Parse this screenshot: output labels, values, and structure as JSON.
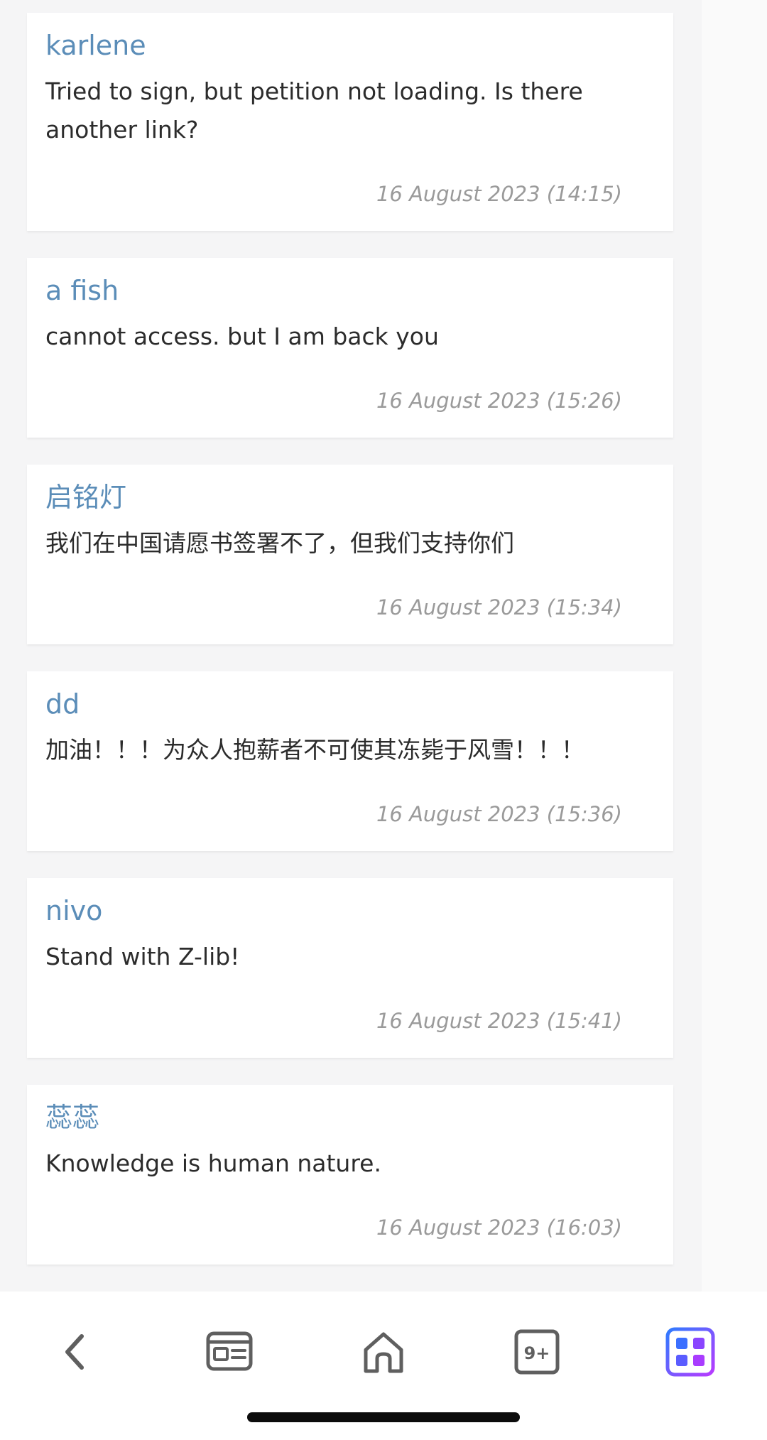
{
  "comments": [
    {
      "author": "karlene",
      "text": "Tried to sign, but petition not loading. Is there another link?",
      "timestamp": "16 August 2023 (14:15)"
    },
    {
      "author": "a fish",
      "text": "cannot access. but I am back you",
      "timestamp": "16 August 2023 (15:26)"
    },
    {
      "author": "启铭灯",
      "text": "我们在中国请愿书签署不了，但我们支持你们",
      "timestamp": "16 August 2023 (15:34)"
    },
    {
      "author": "dd",
      "text": "加油！！！为众人抱薪者不可使其冻毙于风雪！！！",
      "timestamp": "16 August 2023 (15:36)"
    },
    {
      "author": "nivo",
      "text": "Stand with Z-lib!",
      "timestamp": "16 August 2023 (15:41)"
    },
    {
      "author": "蕊蕊",
      "text": "Knowledge is human nature.",
      "timestamp": "16 August 2023 (16:03)"
    }
  ],
  "bottom_nav": {
    "back_icon": "chevron-left-icon",
    "news_icon": "newspaper-icon",
    "home_icon": "home-icon",
    "tabs_icon": "tabs-count-icon",
    "tabs_count": "9+",
    "apps_icon": "apps-grid-icon"
  },
  "colors": {
    "author": "#5b8db8",
    "body_text": "#2c2c2c",
    "timestamp": "#9a9a9a",
    "nav_icon": "#5f5f5f",
    "apps_gradient_start": "#2f7bff",
    "apps_gradient_end": "#b83bff"
  }
}
